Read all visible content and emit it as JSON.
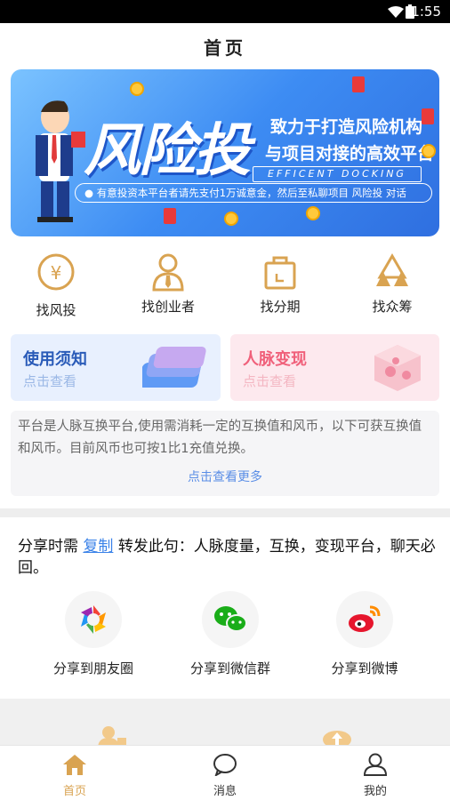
{
  "status_bar": {
    "time": "1:55"
  },
  "header": {
    "title": "首页"
  },
  "banner": {
    "headline": "风险投",
    "line1": "致力于打造风险机构",
    "line2": "与项目对接的高效平台",
    "english": "EFFICENT DOCKING",
    "notice": "有意投资本平台者请先支付1万诚意金，然后至私聊项目 风险投 对话"
  },
  "quick_links": [
    {
      "label": "找风投",
      "icon": "yuan-coin-icon"
    },
    {
      "label": "找创业者",
      "icon": "person-tie-icon"
    },
    {
      "label": "找分期",
      "icon": "shopping-bag-icon"
    },
    {
      "label": "找众筹",
      "icon": "triangles-icon"
    }
  ],
  "cards": [
    {
      "title": "使用须知",
      "subtitle": "点击查看",
      "title_color": "#2a5bb8",
      "bg": "#e8f0fe"
    },
    {
      "title": "人脉变现",
      "subtitle": "点击查看",
      "title_color": "#f0607a",
      "bg": "#fde9ee"
    }
  ],
  "info": {
    "text": "平台是人脉互换平台,使用需消耗一定的互换值和风币，以下可获互换值和风币。目前风币也可按1比1充值兑换。",
    "more": "点击查看更多"
  },
  "share": {
    "prefix": "分享时需",
    "copy_link": "复制",
    "suffix": "转发此句：人脉度量，互换，变现平台，聊天必回。",
    "targets": [
      {
        "label": "分享到朋友圈",
        "icon": "moments-icon"
      },
      {
        "label": "分享到微信群",
        "icon": "wechat-icon"
      },
      {
        "label": "分享到微博",
        "icon": "weibo-icon"
      }
    ]
  },
  "tabbar": {
    "items": [
      {
        "label": "首页",
        "icon": "home-icon",
        "active": true
      },
      {
        "label": "消息",
        "icon": "message-icon",
        "active": false
      },
      {
        "label": "我的",
        "icon": "profile-icon",
        "active": false
      }
    ],
    "active_color": "#d9a351"
  }
}
